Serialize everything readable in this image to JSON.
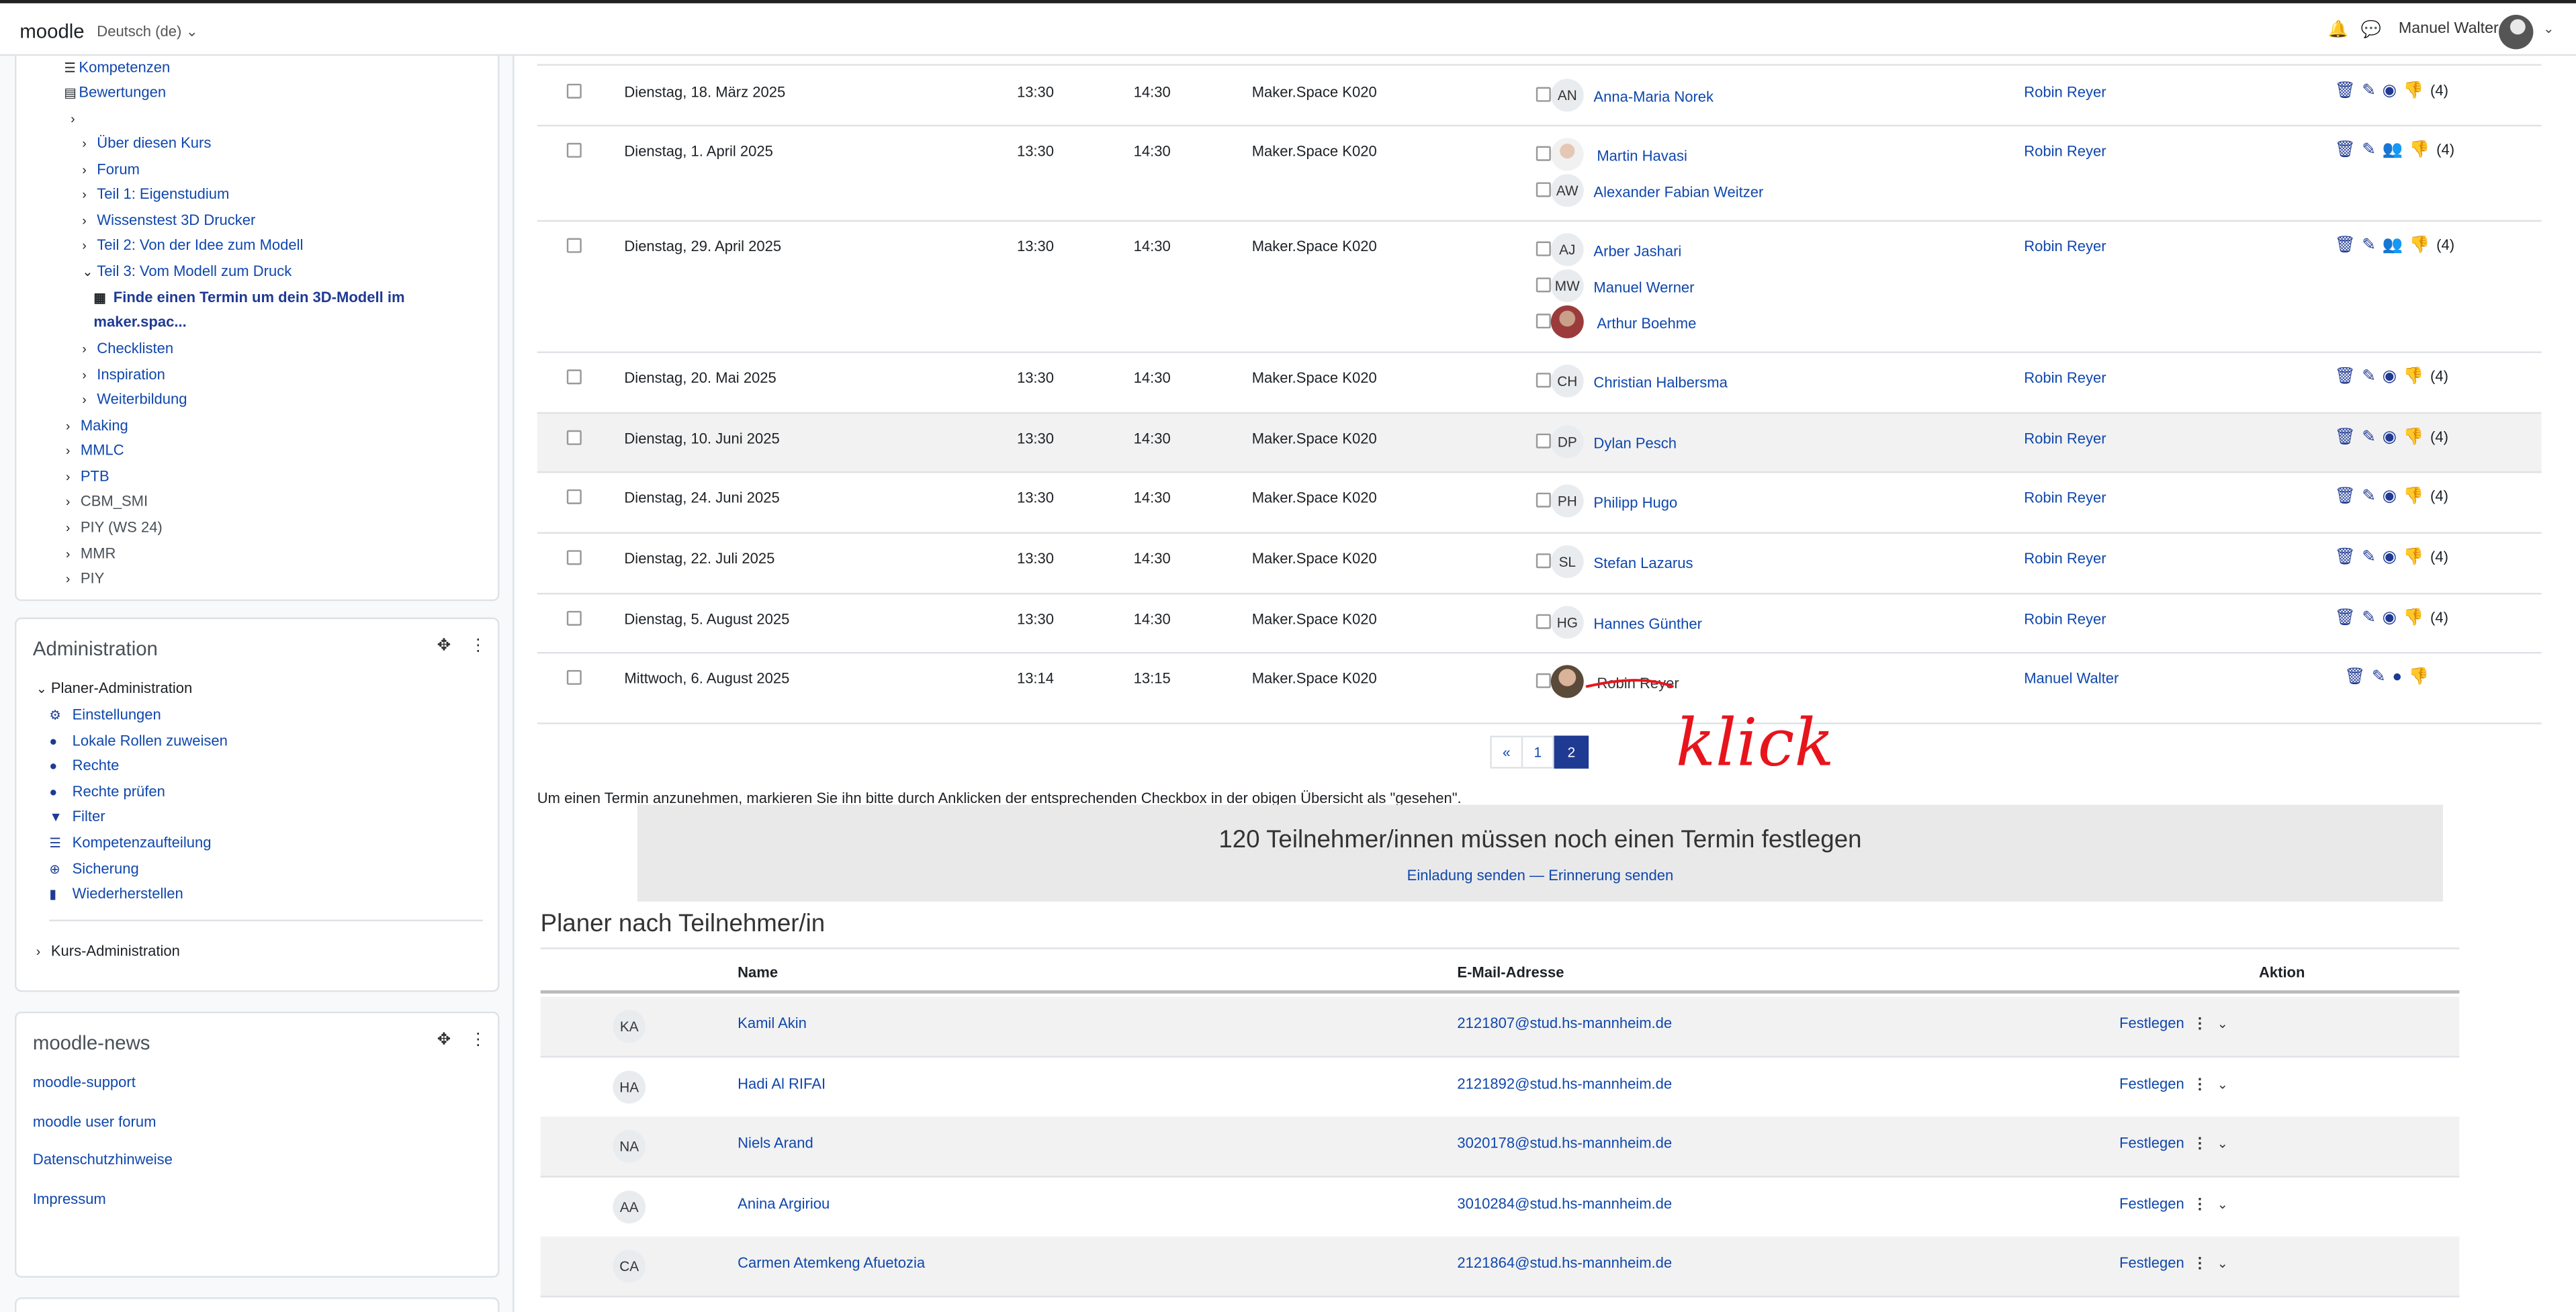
{
  "topbar": {
    "logo": "moodle",
    "language": "Deutsch (de)",
    "user_name": "Manuel Walter"
  },
  "sidebar": {
    "nav_items": [
      {
        "label": "Kompetenzen",
        "icon": "list-icon"
      },
      {
        "label": "Bewertungen",
        "icon": "clipboard-icon"
      },
      {
        "label": "",
        "icon": "chevron-right-icon"
      },
      {
        "label": "Über diesen Kurs",
        "icon": "chevron-right-icon"
      },
      {
        "label": "Forum",
        "icon": "chevron-right-icon"
      },
      {
        "label": "Teil 1: Eigenstudium",
        "icon": "chevron-right-icon"
      },
      {
        "label": "Wissenstest 3D Drucker",
        "icon": "chevron-right-icon"
      },
      {
        "label": "Teil 2: Von der Idee zum Modell",
        "icon": "chevron-right-icon"
      },
      {
        "label": "Teil 3: Vom Modell zum Druck",
        "icon": "chevron-down-icon"
      },
      {
        "label": "Finde einen Termin um dein 3D-Modell im",
        "icon": "scheduler-icon"
      },
      {
        "label": "maker.spac...",
        "icon": ""
      },
      {
        "label": "Checklisten",
        "icon": "chevron-right-icon"
      },
      {
        "label": "Inspiration",
        "icon": "chevron-right-icon"
      },
      {
        "label": "Weiterbildung",
        "icon": "chevron-right-icon"
      },
      {
        "label": "Making",
        "icon": "chevron-right-icon"
      },
      {
        "label": "MMLC",
        "icon": "chevron-right-icon"
      },
      {
        "label": "PTB",
        "icon": "chevron-right-icon"
      },
      {
        "label": "CBM_SMI",
        "icon": "chevron-right-icon"
      },
      {
        "label": "PIY (WS 24)",
        "icon": "chevron-right-icon"
      },
      {
        "label": "MMR",
        "icon": "chevron-right-icon"
      },
      {
        "label": "PIY",
        "icon": "chevron-right-icon"
      }
    ],
    "admin": {
      "title": "Administration",
      "section": "Planer-Administration",
      "items": [
        {
          "label": "Einstellungen",
          "icon": "gear-icon"
        },
        {
          "label": "Lokale Rollen zuweisen",
          "icon": "user-icon"
        },
        {
          "label": "Rechte",
          "icon": "user-key-icon"
        },
        {
          "label": "Rechte prüfen",
          "icon": "user-check-icon"
        },
        {
          "label": "Filter",
          "icon": "filter-icon"
        },
        {
          "label": "Kompetenzaufteilung",
          "icon": "list-icon"
        },
        {
          "label": "Sicherung",
          "icon": "download-icon"
        },
        {
          "label": "Wiederherstellen",
          "icon": "trash-restore-icon"
        }
      ],
      "course_admin": "Kurs-Administration"
    },
    "news": {
      "title": "moodle-news",
      "links": [
        "moodle-support",
        "moodle user forum",
        "Datenschutzhinweise",
        "Impressum"
      ]
    }
  },
  "slots": [
    {
      "date": "Dienstag, 18. März 2025",
      "start": "13:30",
      "end": "14:30",
      "location": "Maker.Space K020",
      "students": [
        {
          "initials": "AN",
          "name": "Anna-Maria Norek"
        }
      ],
      "teacher": "Robin Reyer",
      "count": "(4)"
    },
    {
      "date": "Dienstag, 1. April 2025",
      "start": "13:30",
      "end": "14:30",
      "location": "Maker.Space K020",
      "students": [
        {
          "initials": "",
          "name": "Martin Havasi"
        },
        {
          "initials": "AW",
          "name": "Alexander Fabian Weitzer"
        }
      ],
      "teacher": "Robin Reyer",
      "count": "(4)"
    },
    {
      "date": "Dienstag, 29. April 2025",
      "start": "13:30",
      "end": "14:30",
      "location": "Maker.Space K020",
      "students": [
        {
          "initials": "AJ",
          "name": "Arber Jashari"
        },
        {
          "initials": "MW",
          "name": "Manuel Werner"
        },
        {
          "initials": "",
          "name": "Arthur Boehme"
        }
      ],
      "teacher": "Robin Reyer",
      "count": "(4)"
    },
    {
      "date": "Dienstag, 20. Mai 2025",
      "start": "13:30",
      "end": "14:30",
      "location": "Maker.Space K020",
      "students": [
        {
          "initials": "CH",
          "name": "Christian Halbersma"
        }
      ],
      "teacher": "Robin Reyer",
      "count": "(4)"
    },
    {
      "date": "Dienstag, 10. Juni 2025",
      "start": "13:30",
      "end": "14:30",
      "location": "Maker.Space K020",
      "students": [
        {
          "initials": "DP",
          "name": "Dylan Pesch"
        }
      ],
      "teacher": "Robin Reyer",
      "count": "(4)"
    },
    {
      "date": "Dienstag, 24. Juni 2025",
      "start": "13:30",
      "end": "14:30",
      "location": "Maker.Space K020",
      "students": [
        {
          "initials": "PH",
          "name": "Philipp Hugo"
        }
      ],
      "teacher": "Robin Reyer",
      "count": "(4)"
    },
    {
      "date": "Dienstag, 22. Juli 2025",
      "start": "13:30",
      "end": "14:30",
      "location": "Maker.Space K020",
      "students": [
        {
          "initials": "SL",
          "name": "Stefan Lazarus"
        }
      ],
      "teacher": "Robin Reyer",
      "count": "(4)"
    },
    {
      "date": "Dienstag, 5. August 2025",
      "start": "13:30",
      "end": "14:30",
      "location": "Maker.Space K020",
      "students": [
        {
          "initials": "HG",
          "name": "Hannes Günther"
        }
      ],
      "teacher": "Robin Reyer",
      "count": "(4)"
    },
    {
      "date": "Mittwoch, 6. August 2025",
      "start": "13:14",
      "end": "13:15",
      "location": "Maker.Space K020",
      "students": [
        {
          "initials": "",
          "name": "Robin Reyer"
        }
      ],
      "teacher": "Manuel Walter",
      "count": ""
    }
  ],
  "pagination": {
    "prev": "«",
    "pages": [
      "1",
      "2"
    ],
    "active": "2"
  },
  "annotation": {
    "text": "klick",
    "color": "#e8141c"
  },
  "instruction": "Um einen Termin anzunehmen, markieren Sie ihn bitte durch Anklicken der entsprechenden Checkbox in der obigen Übersicht als \"gesehen\".",
  "banner": {
    "headline": "120 Teilnehmer/innen müssen noch einen Termin festlegen",
    "invite": "Einladung senden",
    "separator": "—",
    "reminder": "Erinnerung senden"
  },
  "participants": {
    "title": "Planer nach Teilnehmer/in",
    "headers": {
      "name": "Name",
      "email": "E-Mail-Adresse",
      "action": "Aktion"
    },
    "rows": [
      {
        "initials": "KA",
        "name": "Kamil Akin",
        "email": "2121807@stud.hs-mannheim.de",
        "action": "Festlegen"
      },
      {
        "initials": "HA",
        "name": "Hadi Al RIFAI",
        "email": "2121892@stud.hs-mannheim.de",
        "action": "Festlegen"
      },
      {
        "initials": "NA",
        "name": "Niels Arand",
        "email": "3020178@stud.hs-mannheim.de",
        "action": "Festlegen"
      },
      {
        "initials": "AA",
        "name": "Anina Argiriou",
        "email": "3010284@stud.hs-mannheim.de",
        "action": "Festlegen"
      },
      {
        "initials": "CA",
        "name": "Carmen Atemkeng Afuetozia",
        "email": "2121864@stud.hs-mannheim.de",
        "action": "Festlegen"
      }
    ]
  },
  "colors": {
    "link": "#0f47ad",
    "accent": "#1f3a93",
    "thumb": "#f0ad4e"
  }
}
